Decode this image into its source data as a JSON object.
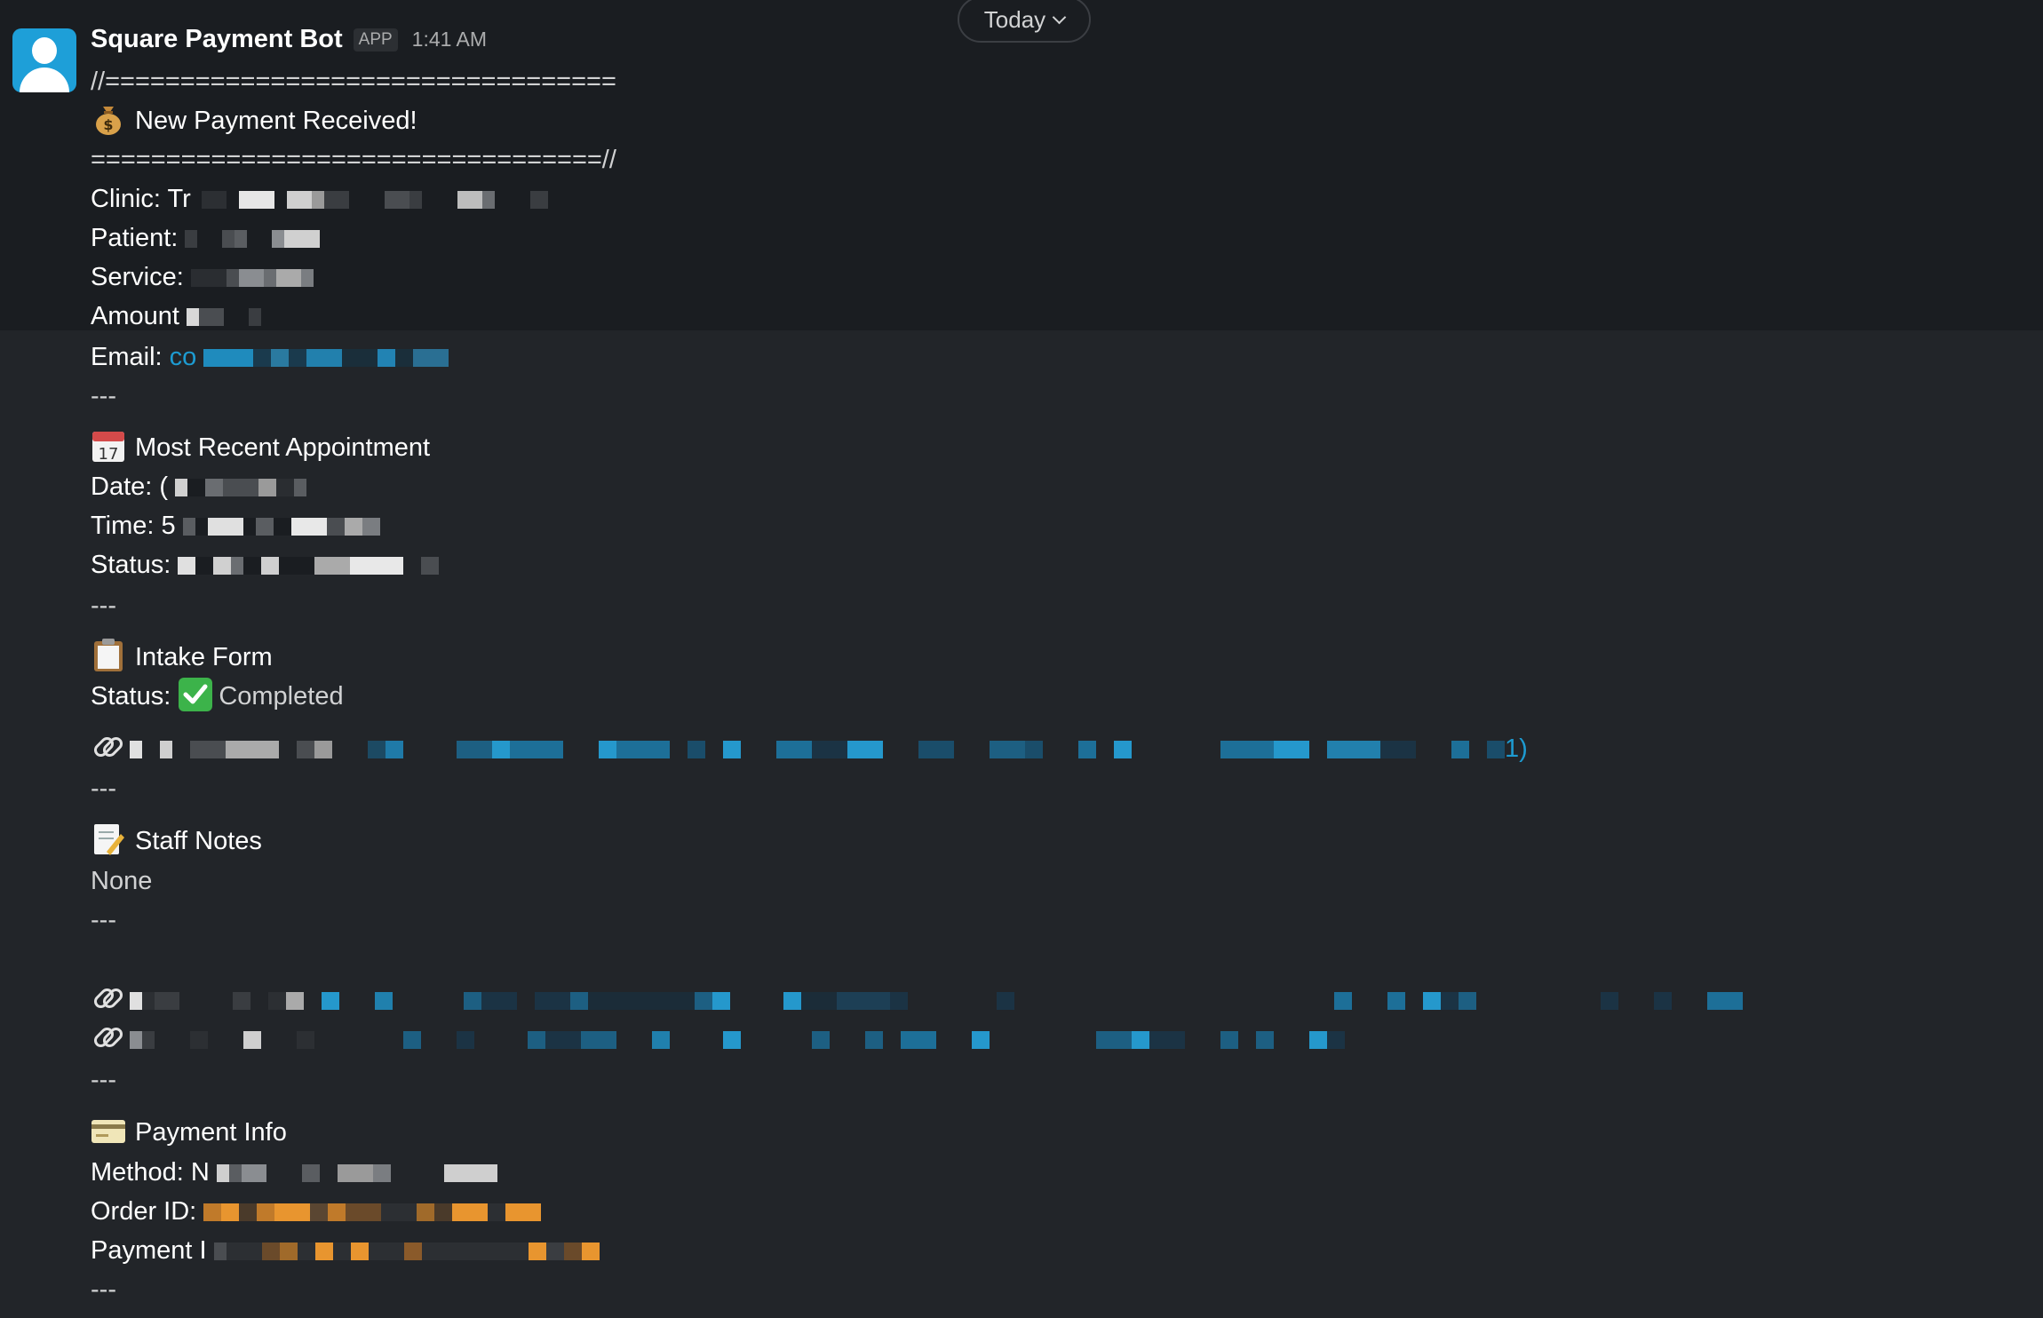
{
  "date_divider": {
    "label": "Today"
  },
  "message": {
    "sender": "Square Payment Bot",
    "badge": "APP",
    "time": "1:41 AM",
    "lines": {
      "divider_top": "//==================================",
      "title": "New Payment Received!",
      "divider_bottom": "==================================//",
      "clinic_label": "Clinic: ",
      "clinic_value_start": "Tr",
      "patient_label": "Patient:",
      "service_label": "Service:",
      "amount_label": "Amount",
      "email_label": "Email: ",
      "email_value_start": "co",
      "sep1": "---",
      "appointment_title": "Most Recent Appointment",
      "date_label": "Date: ",
      "date_value_start": "(",
      "time_label": "Time: ",
      "time_value_start": "5",
      "status_label": "Status:",
      "sep2": "---",
      "intake_title": "Intake Form",
      "intake_status_label": "Status: ",
      "intake_status_value": "Completed",
      "intake_link_end": "1)",
      "sep3": "---",
      "notes_title": "Staff Notes",
      "notes_value": "None",
      "sep4": "---",
      "sep5": "---",
      "payment_title": "Payment Info",
      "method_label": "Method: ",
      "method_value_start": "N",
      "order_label": "Order ID:",
      "payment_id_label": "Payment I",
      "sep6": "---"
    }
  },
  "colors": {
    "background": "#1a1d21",
    "link": "#1d9bd1",
    "redacted_orange": "#e8952f"
  }
}
